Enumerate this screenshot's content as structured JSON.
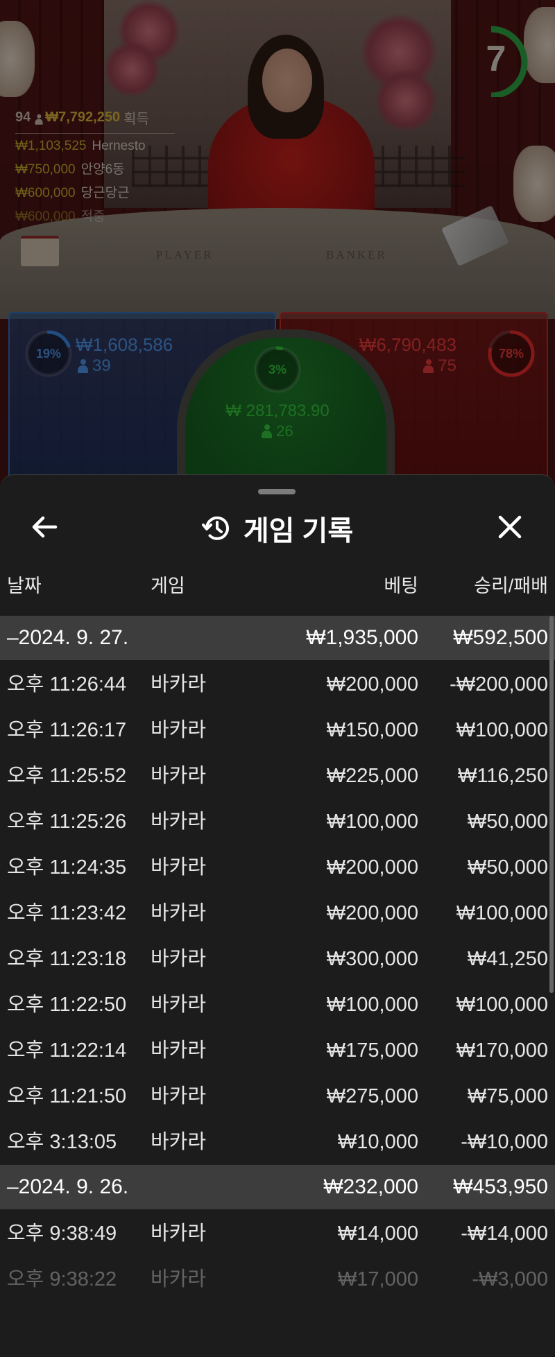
{
  "game": {
    "timer": "7",
    "winners": {
      "count": "94",
      "total": "₩7,792,250",
      "suffix": "획득",
      "list": [
        {
          "amount": "₩1,103,525",
          "name": "Hernesto"
        },
        {
          "amount": "₩750,000",
          "name": "안양6동"
        },
        {
          "amount": "₩600,000",
          "name": "당근당근"
        },
        {
          "amount": "₩600,000",
          "name": "적중"
        }
      ]
    },
    "table_labels": {
      "player": "PLAYER",
      "banker": "BANKER"
    },
    "player": {
      "percent": "19%",
      "percent_value": 0.19,
      "stake": "₩1,608,586",
      "players": "39",
      "color": "#2f6bbd"
    },
    "tie": {
      "percent": "3%",
      "percent_value": 0.03,
      "stake": "₩ 281,783.90",
      "players": "26",
      "color": "#28a02f"
    },
    "banker": {
      "percent": "78%",
      "percent_value": 0.78,
      "stake": "₩6,790,483",
      "players": "75",
      "color": "#c02626"
    }
  },
  "sheet": {
    "title": "게임 기록",
    "columns": {
      "date": "날짜",
      "game": "게임",
      "bet": "베팅",
      "result": "승리/패배"
    },
    "groups": [
      {
        "date": "–2024. 9. 27.",
        "bet": "₩1,935,000",
        "result": "₩592,500",
        "rows": [
          {
            "time": "오후 11:26:44",
            "game": "바카라",
            "bet": "₩200,000",
            "result": "-₩200,000"
          },
          {
            "time": "오후 11:26:17",
            "game": "바카라",
            "bet": "₩150,000",
            "result": "₩100,000"
          },
          {
            "time": "오후 11:25:52",
            "game": "바카라",
            "bet": "₩225,000",
            "result": "₩116,250"
          },
          {
            "time": "오후 11:25:26",
            "game": "바카라",
            "bet": "₩100,000",
            "result": "₩50,000"
          },
          {
            "time": "오후 11:24:35",
            "game": "바카라",
            "bet": "₩200,000",
            "result": "₩50,000"
          },
          {
            "time": "오후 11:23:42",
            "game": "바카라",
            "bet": "₩200,000",
            "result": "₩100,000"
          },
          {
            "time": "오후 11:23:18",
            "game": "바카라",
            "bet": "₩300,000",
            "result": "₩41,250"
          },
          {
            "time": "오후 11:22:50",
            "game": "바카라",
            "bet": "₩100,000",
            "result": "₩100,000"
          },
          {
            "time": "오후 11:22:14",
            "game": "바카라",
            "bet": "₩175,000",
            "result": "₩170,000"
          },
          {
            "time": "오후 11:21:50",
            "game": "바카라",
            "bet": "₩275,000",
            "result": "₩75,000"
          },
          {
            "time": "오후 3:13:05",
            "game": "바카라",
            "bet": "₩10,000",
            "result": "-₩10,000"
          }
        ]
      },
      {
        "date": "–2024. 9. 26.",
        "bet": "₩232,000",
        "result": "₩453,950",
        "rows": [
          {
            "time": "오후 9:38:49",
            "game": "바카라",
            "bet": "₩14,000",
            "result": "-₩14,000"
          },
          {
            "time": "오후 9:38:22",
            "game": "바카라",
            "bet": "₩17,000",
            "result": "-₩3,000"
          }
        ]
      }
    ]
  }
}
